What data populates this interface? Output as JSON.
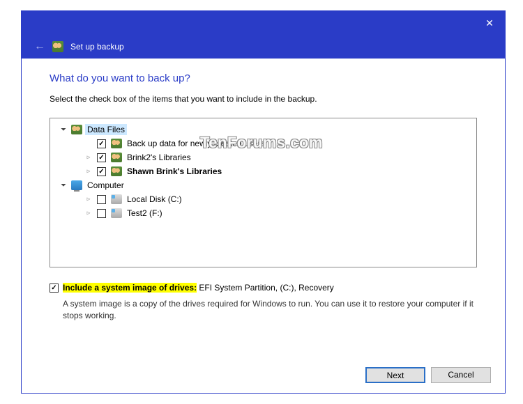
{
  "header": {
    "title": "Set up backup"
  },
  "heading": "What do you want to back up?",
  "subtext": "Select the check box of the items that you want to include in the backup.",
  "tree": {
    "data_files": {
      "label": "Data Files",
      "new_users": "Back up data for newly created users",
      "lib1": "Brink2's Libraries",
      "lib2": "Shawn Brink's Libraries"
    },
    "computer": {
      "label": "Computer",
      "drive_c": "Local Disk (C:)",
      "drive_f": "Test2 (F:)"
    }
  },
  "sys_image": {
    "label_bold": "Include a system image of drives:",
    "label_rest": " EFI System Partition, (C:), Recovery",
    "note": "A system image is a copy of the drives required for Windows to run. You can use it to restore your computer if it stops working."
  },
  "buttons": {
    "next": "Next",
    "cancel": "Cancel"
  },
  "watermark": "TenForums.com"
}
